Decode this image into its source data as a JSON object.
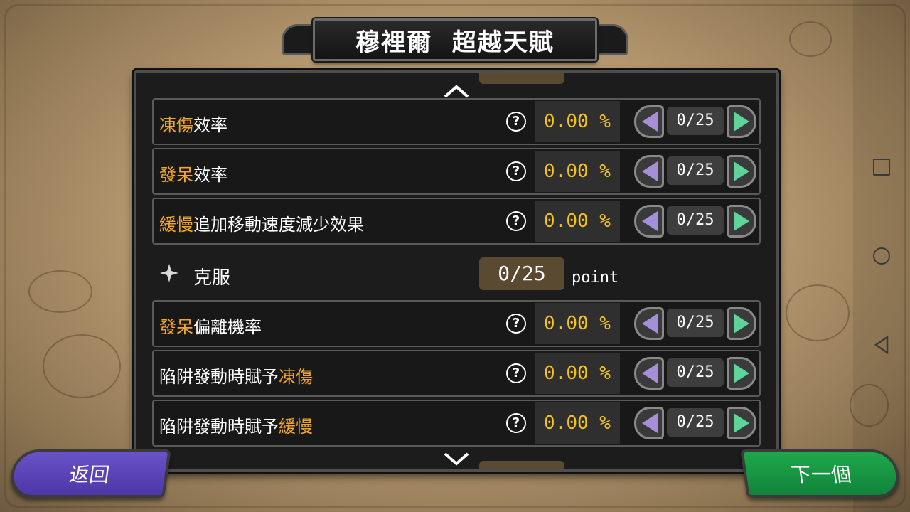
{
  "title": "穆裡爾  超越天賦",
  "rows_top": [
    {
      "label_hl": "凍傷",
      "label_rest": "效率",
      "value": "0.00 %",
      "count": "0/25"
    },
    {
      "label_hl": "發呆",
      "label_rest": "效率",
      "value": "0.00 %",
      "count": "0/25"
    },
    {
      "label_hl": "緩慢",
      "label_rest": "追加移動速度減少效果",
      "value": "0.00 %",
      "count": "0/25"
    }
  ],
  "section": {
    "label": "克服",
    "points": "0/25",
    "unit": "point"
  },
  "rows_bottom": [
    {
      "label_pre": "",
      "label_hl": "發呆",
      "label_rest": "偏離機率",
      "value": "0.00 %",
      "count": "0/25"
    },
    {
      "label_pre": "陷阱發動時賦予",
      "label_hl": "凍傷",
      "label_rest": "",
      "value": "0.00 %",
      "count": "0/25"
    },
    {
      "label_pre": "陷阱發動時賦予",
      "label_hl": "緩慢",
      "label_rest": "",
      "value": "0.00 %",
      "count": "0/25"
    }
  ],
  "help_glyph": "?",
  "buttons": {
    "back": "返回",
    "next": "下一個"
  },
  "colors": {
    "highlight": "#f2a62a",
    "value": "#f5c21b",
    "back": "#5b43b8",
    "next": "#17963f"
  }
}
